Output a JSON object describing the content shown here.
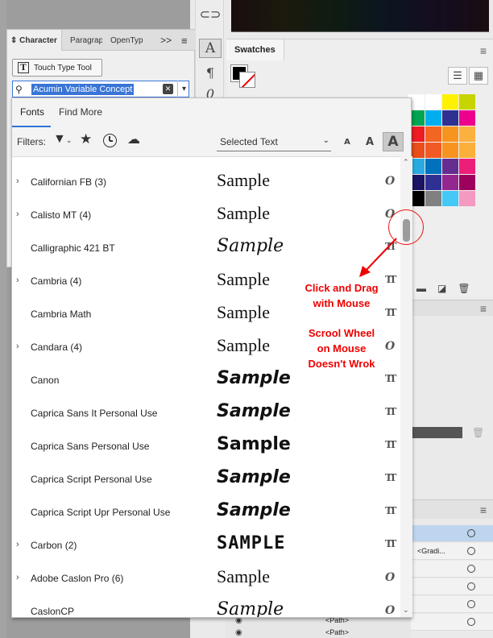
{
  "tool_strip": {
    "para_glyph": "¶",
    "charstyle_glyph": "A",
    "glyph_glyph": "0"
  },
  "swatches": {
    "title": "Swatches",
    "colors": [
      "#ffffff",
      "#ffffff",
      "#fff200",
      "#c8d400",
      "#00a651",
      "#00aeef",
      "#2e3192",
      "#ec008c",
      "#ed1c24",
      "#f26522",
      "#f7941d",
      "#fbb040",
      "#e94e1b",
      "#f15a24",
      "#f7931e",
      "#fbb03b",
      "#29abe2",
      "#0071bc",
      "#662d91",
      "#ed1e79",
      "#1b1464",
      "#2e3192",
      "#93278f",
      "#9e005d",
      "#000000",
      "#808080",
      "#44c8f5",
      "#f49ac1"
    ]
  },
  "character_panel": {
    "tabs": {
      "character": "Character",
      "paragraph": "Paragrap",
      "opentype": "OpenTyp",
      "more": ">>",
      "menu": "≡"
    },
    "touch_type_label": "Touch Type Tool",
    "font_value": "Acumin Variable Concept"
  },
  "font_dropdown": {
    "tab_fonts": "Fonts",
    "tab_find_more": "Find More",
    "filters_label": "Filters:",
    "preview_mode": "Selected Text",
    "size_small": "A",
    "size_medium": "A",
    "size_large": "A",
    "fonts": [
      {
        "name": "Californian FB (3)",
        "expandable": true,
        "sample": "Sample",
        "type": "O"
      },
      {
        "name": "Calisto MT (4)",
        "expandable": true,
        "sample": "Sample",
        "type": "O"
      },
      {
        "name": "Calligraphic 421 BT",
        "expandable": false,
        "sample": "Sample",
        "type": "TT"
      },
      {
        "name": "Cambria (4)",
        "expandable": true,
        "sample": "Sample",
        "type": "TT"
      },
      {
        "name": "Cambria Math",
        "expandable": false,
        "sample": "Sample",
        "type": "TT"
      },
      {
        "name": "Candara (4)",
        "expandable": true,
        "sample": "Sample",
        "type": "O"
      },
      {
        "name": "Canon",
        "expandable": false,
        "sample": "Sample",
        "type": "TT"
      },
      {
        "name": "Caprica Sans It Personal Use",
        "expandable": false,
        "sample": "Sample",
        "type": "TT"
      },
      {
        "name": "Caprica Sans Personal Use",
        "expandable": false,
        "sample": "Sample",
        "type": "TT"
      },
      {
        "name": "Caprica Script Personal Use",
        "expandable": false,
        "sample": "Sample",
        "type": "TT"
      },
      {
        "name": "Caprica Script Upr Personal Use",
        "expandable": false,
        "sample": "Sample",
        "type": "TT"
      },
      {
        "name": "Carbon (2)",
        "expandable": true,
        "sample": "SAMPLE",
        "type": "TT"
      },
      {
        "name": "Adobe Caslon Pro (6)",
        "expandable": true,
        "sample": "Sample",
        "type": "O"
      },
      {
        "name": "CaslonCP",
        "expandable": false,
        "sample": "Sample",
        "type": "O"
      }
    ]
  },
  "annotations": {
    "drag_line1": "Click and Drag",
    "drag_line2": "with Mouse",
    "wheel_line1": "Scrool Wheel",
    "wheel_line2": "on Mouse",
    "wheel_line3": "Doesn't Wrok"
  },
  "layers": {
    "row_label": "<Path>",
    "gradient_label": "<Gradi..."
  }
}
